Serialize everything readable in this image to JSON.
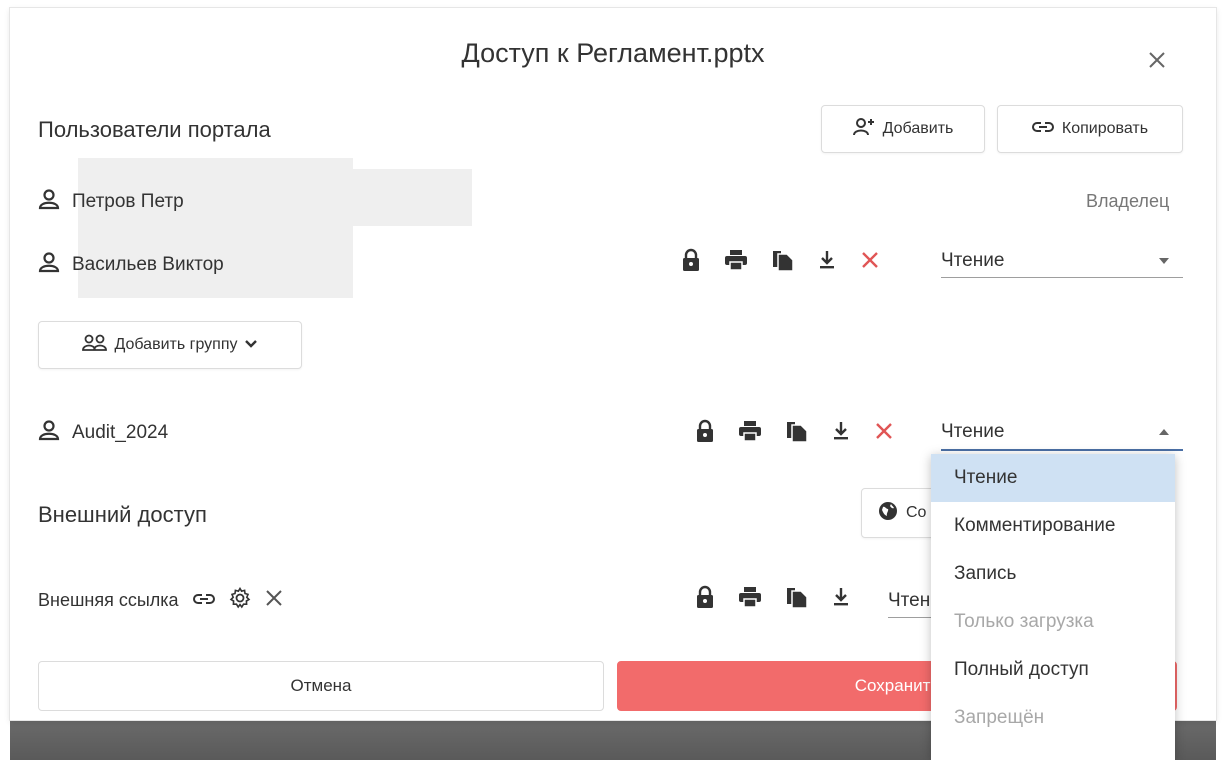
{
  "dialog": {
    "title": "Доступ к Регламент.pptx"
  },
  "portal": {
    "section_title": "Пользователи портала",
    "add_label": "Добавить",
    "copy_label": "Копировать",
    "users": [
      {
        "name": "Петров Петр",
        "role": "Владелец"
      },
      {
        "name": "Васильев Виктор",
        "access": "Чтение"
      }
    ],
    "add_group_label": "Добавить группу",
    "group": {
      "name": "Audit_2024",
      "access": "Чтение"
    }
  },
  "external": {
    "section_title": "Внешний доступ",
    "button_label": "Со",
    "link_label": "Внешняя ссылка",
    "access": "Чтени"
  },
  "dropdown": {
    "options": [
      "Чтение",
      "Комментирование",
      "Запись",
      "Только загрузка",
      "Полный доступ",
      "Запрещён"
    ],
    "selected_index": 0,
    "disabled": [
      "Только загрузка",
      "Запрещён"
    ]
  },
  "footer": {
    "cancel_label": "Отмена",
    "save_label": "Сохранить"
  },
  "colors": {
    "accent": "#f26b6b",
    "selected_bg": "#cfe1f3",
    "active_underline": "#4a6fa5",
    "remove_x": "#e05555"
  }
}
